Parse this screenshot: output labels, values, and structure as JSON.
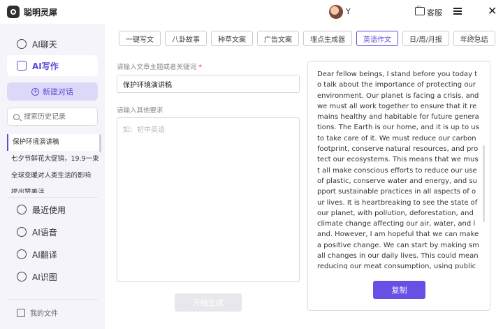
{
  "app": {
    "name": "聪明灵犀"
  },
  "header": {
    "user_name": "Y",
    "service_label": "客服"
  },
  "sidebar": {
    "nav_top": [
      {
        "label": "AI聊天",
        "icon": "chat-bubble-icon"
      },
      {
        "label": "AI写作",
        "icon": "pen-icon",
        "active": true
      }
    ],
    "new_chat_label": "新建对话",
    "search_placeholder": "搜索历史记录",
    "history": [
      "保护环境演讲稿",
      "七夕节鲜花大促销，19.9一束",
      "全球变暖对人类生活的影响",
      "提出赞美活...."
    ],
    "nav_bottom": [
      {
        "label": "最近使用",
        "icon": "clock-icon"
      },
      {
        "label": "AI语音",
        "icon": "microphone-icon"
      },
      {
        "label": "AI翻译",
        "icon": "translate-icon"
      },
      {
        "label": "AI识图",
        "icon": "image-recognition-icon"
      }
    ],
    "files_label": "我的文件"
  },
  "tabs": [
    {
      "label": "一键写文"
    },
    {
      "label": "八卦故事"
    },
    {
      "label": "种草文案"
    },
    {
      "label": "广告文案"
    },
    {
      "label": "埋点生成器"
    },
    {
      "label": "英语作文",
      "active": true
    },
    {
      "label": "日/周/月报"
    },
    {
      "label": "年终总结"
    }
  ],
  "form": {
    "topic_label": "请输入文章主题或者关键词",
    "required_mark": "*",
    "topic_value": "保护环境演讲稿",
    "extra_label": "请输入其他要求",
    "extra_placeholder": "如：初中英语",
    "generate_label": "开始生成"
  },
  "output": {
    "text": "Dear fellow beings, I stand before you today to talk about the importance of protecting our environment. Our planet is facing a crisis, and we must all work together to ensure that it remains healthy and habitable for future generations. The Earth is our home, and it is up to us to take care of it. We must reduce our carbon footprint, conserve natural resources, and protect our ecosystems. This means that we must all make conscious efforts to reduce our use of plastic, conserve water and energy, and support sustainable practices in all aspects of our lives. It is heartbreaking to see the state of our planet, with pollution, deforestation, and climate change affecting our air, water, and land. However, I am hopeful that we can make a positive change. We can start by making small changes in our daily lives. This could mean reducing our meat consumption, using public transportation, or recycling waste. We can also support organizations that are working to protect the environment and promote sustainable practices. It is important to remember that our actions today will have a direct",
    "copy_label": "复制"
  }
}
